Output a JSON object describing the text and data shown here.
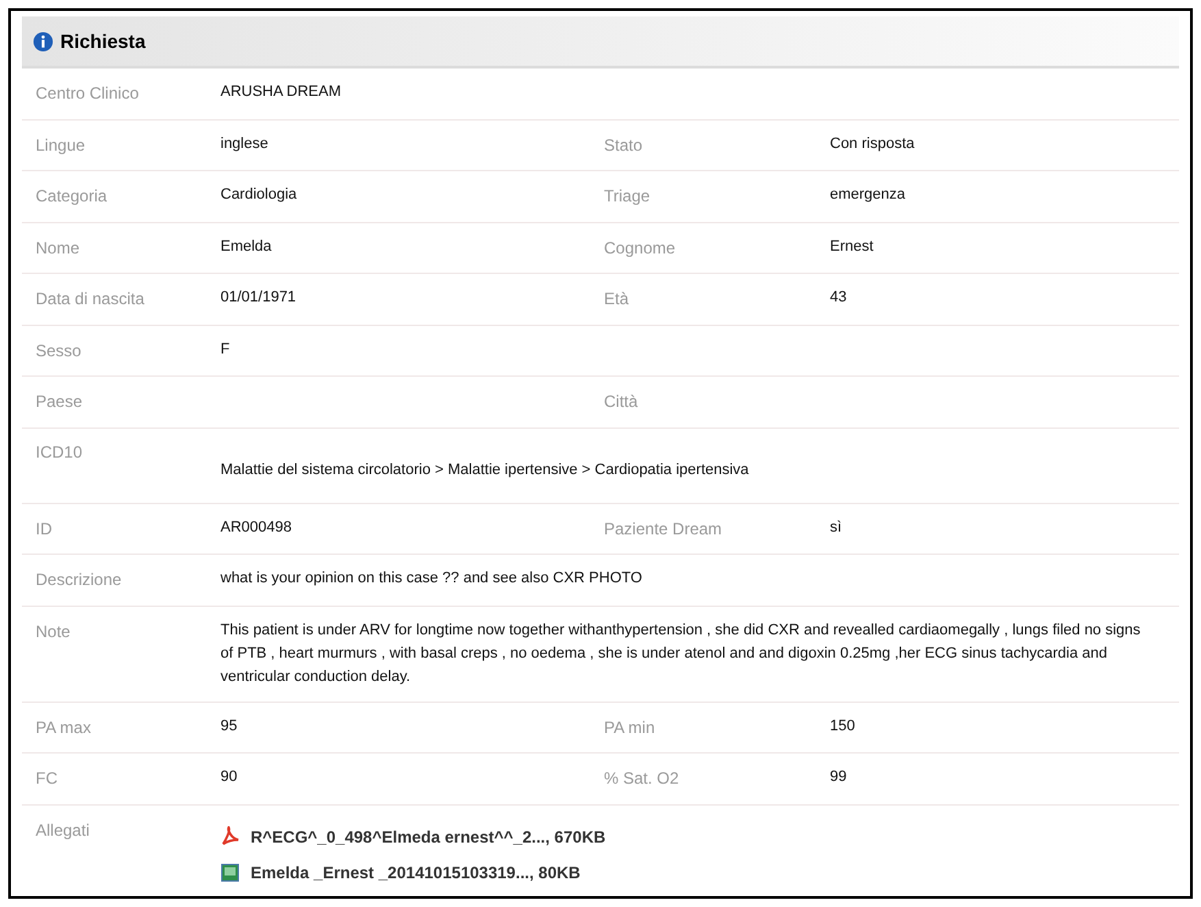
{
  "panel": {
    "title": "Richiesta"
  },
  "rows": [
    {
      "label": "Centro Clinico",
      "value": "ARUSHA DREAM"
    },
    {
      "label": "Lingue",
      "value": "inglese",
      "label2": "Stato",
      "value2": "Con risposta"
    },
    {
      "label": "Categoria",
      "value": "Cardiologia",
      "label2": "Triage",
      "value2": "emergenza"
    },
    {
      "label": "Nome",
      "value": "Emelda",
      "label2": "Cognome",
      "value2": "Ernest"
    },
    {
      "label": "Data di nascita",
      "value": "01/01/1971",
      "label2": "Età",
      "value2": "43"
    },
    {
      "label": "Sesso",
      "value": "F"
    },
    {
      "label": "Paese",
      "label2": "Città"
    },
    {
      "label": "ICD10",
      "value": "Malattie del sistema circolatorio > Malattie ipertensive > Cardiopatia ipertensiva",
      "kind": "offset"
    },
    {
      "label": "ID",
      "value": "AR000498",
      "label2": "Paziente Dream",
      "value2": "sì"
    },
    {
      "label": "Descrizione",
      "value": "what is your opinion on this case ?? and see also CXR PHOTO"
    },
    {
      "label": "Note",
      "value": "This patient is under ARV for longtime now  together withanthypertension , she did CXR  and revealled cardiaomegally , lungs filed no signs of PTB  , heart murmurs , with basal creps , no oedema , she is under atenol  and and digoxin 0.25mg ,her ECG sinus tachycardia and ventricular conduction delay."
    },
    {
      "label": "PA max",
      "value": "95",
      "label2": "PA min",
      "value2": "150"
    },
    {
      "label": "FC",
      "value": "90",
      "label2": "% Sat. O2",
      "value2": "99"
    }
  ],
  "attachments": {
    "label": "Allegati",
    "files": [
      {
        "kind": "pdf",
        "name": "R^ECG^_0_498^Elmeda ernest^^_2..., 670KB"
      },
      {
        "kind": "image",
        "name": "Emelda _Ernest _20141015103319..., 80KB"
      }
    ]
  }
}
